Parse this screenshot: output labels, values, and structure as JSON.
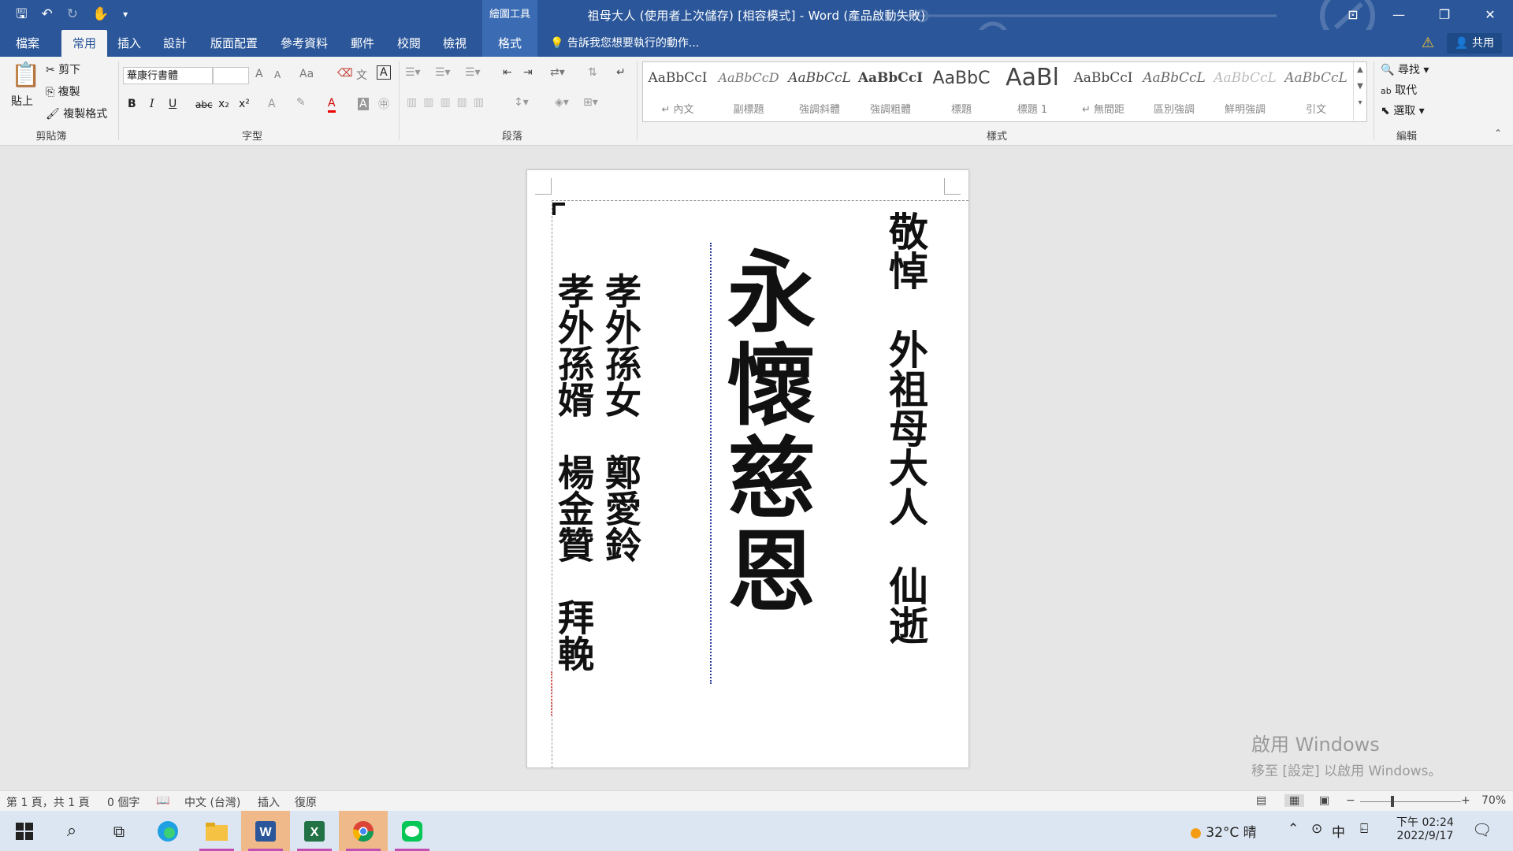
{
  "window": {
    "title": "祖母大人 (使用者上次儲存) [相容模式] - Word (產品啟動失敗)",
    "context_tab_header": "繪圖工具"
  },
  "qat": {
    "save_icon": "save-icon",
    "undo_icon": "undo-icon",
    "redo_icon": "redo-icon",
    "customize_icon": "customize-icon"
  },
  "tabs": [
    "檔案",
    "常用",
    "插入",
    "設計",
    "版面配置",
    "參考資料",
    "郵件",
    "校閱",
    "檢視",
    "格式"
  ],
  "tell_me": "告訴我您想要執行的動作...",
  "share": "共用",
  "clipboard": {
    "paste": "貼上",
    "cut": "剪下",
    "copy": "複製",
    "format_painter": "複製格式",
    "label": "剪貼簿"
  },
  "font": {
    "name": "華康行書體",
    "size": "",
    "label": "字型",
    "bold": "B",
    "italic": "I",
    "underline": "U",
    "strike": "abc",
    "sub": "x₂",
    "sup": "x²",
    "grow": "A",
    "shrink": "A",
    "case": "Aa"
  },
  "paragraph": {
    "label": "段落"
  },
  "styles": {
    "label": "樣式",
    "items": [
      {
        "preview": "AaBbCcI",
        "name": "↵ 內文"
      },
      {
        "preview": "AaBbCcD",
        "name": "副標題"
      },
      {
        "preview": "AaBbCcL",
        "name": "強調斜體"
      },
      {
        "preview": "AaBbCcI",
        "name": "強調粗體"
      },
      {
        "preview": "AaBbC",
        "name": "標題"
      },
      {
        "preview": "AaBl",
        "name": "標題 1"
      },
      {
        "preview": "AaBbCcI",
        "name": "↵ 無間距"
      },
      {
        "preview": "AaBbCcL",
        "name": "區別強調"
      },
      {
        "preview": "AaBbCcL",
        "name": "鮮明強調"
      },
      {
        "preview": "AaBbCcL",
        "name": "引文"
      }
    ]
  },
  "editing": {
    "find": "尋找",
    "replace": "取代",
    "select": "選取",
    "label": "編輯"
  },
  "document": {
    "col_right": "敬悼　外祖母大人　仙逝",
    "col_center": "永懷慈恩",
    "col_left1": "孝外孫女　鄭愛鈴",
    "col_left2": "孝外孫婿　楊金贊　拜輓"
  },
  "activation": {
    "line1": "啟用 Windows",
    "line2": "移至 [設定] 以啟用 Windows。"
  },
  "statusbar": {
    "page": "第 1 頁，共 1 頁",
    "words": "0 個字",
    "language": "中文 (台灣)",
    "insert": "插入",
    "recover": "復原",
    "zoom": "70%"
  },
  "taskbar": {
    "weather": "32°C 晴",
    "ime": "中",
    "time": "下午 02:24",
    "date": "2022/9/17"
  }
}
